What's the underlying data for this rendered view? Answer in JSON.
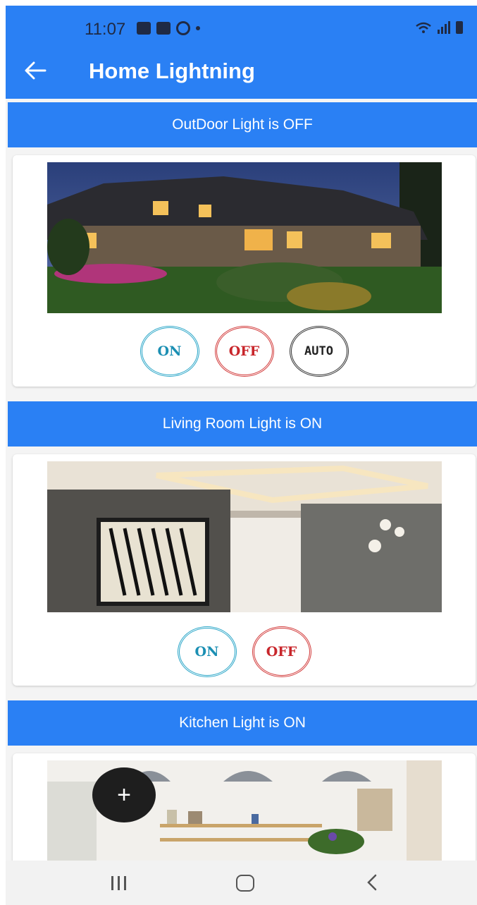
{
  "status_bar": {
    "time": "11:07"
  },
  "app_bar": {
    "title": "Home Lightning",
    "back_icon": "arrow-left-icon"
  },
  "sections": [
    {
      "header": "OutDoor Light is OFF",
      "photo": "outdoor-house-photo",
      "buttons": [
        "ON",
        "OFF",
        "AUTO"
      ]
    },
    {
      "header": "Living Room Light is ON",
      "photo": "living-room-photo",
      "buttons": [
        "ON",
        "OFF"
      ]
    },
    {
      "header": "Kitchen Light is ON",
      "photo": "kitchen-photo",
      "buttons": []
    }
  ],
  "fab": {
    "label": "+",
    "icon": "plus-icon"
  },
  "colors": {
    "primary": "#2a80f4",
    "on": "#1b8fb3",
    "off": "#c8262b",
    "auto": "#222222"
  },
  "nav_bar": {
    "icons": [
      "recents-icon",
      "home-icon",
      "back-icon"
    ]
  }
}
